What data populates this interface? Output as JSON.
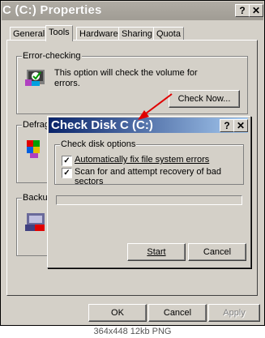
{
  "window": {
    "title": "C (C:) Properties",
    "help_button": "?",
    "close_button": "✕"
  },
  "tabs": [
    {
      "label": "General"
    },
    {
      "label": "Tools"
    },
    {
      "label": "Hardware"
    },
    {
      "label": "Sharing"
    },
    {
      "label": "Quota"
    }
  ],
  "error_checking": {
    "label": "Error-checking",
    "description_line1": "This option will check the volume for",
    "description_line2": "errors.",
    "button": "Check Now..."
  },
  "defrag": {
    "label": "Defrag"
  },
  "backup": {
    "label": "Backu"
  },
  "check_disk": {
    "title": "Check Disk C (C:)",
    "help_button": "?",
    "close_button": "✕",
    "options_label": "Check disk options",
    "option1": "Automatically fix file system errors",
    "option2": "Scan for and attempt recovery of bad sectors",
    "start": "Start",
    "cancel": "Cancel"
  },
  "buttons": {
    "ok": "OK",
    "cancel": "Cancel",
    "apply": "Apply"
  },
  "footer": "364x448 12kb PNG",
  "colors": {
    "accent": "#0a246a",
    "arrow": "#e00000"
  }
}
